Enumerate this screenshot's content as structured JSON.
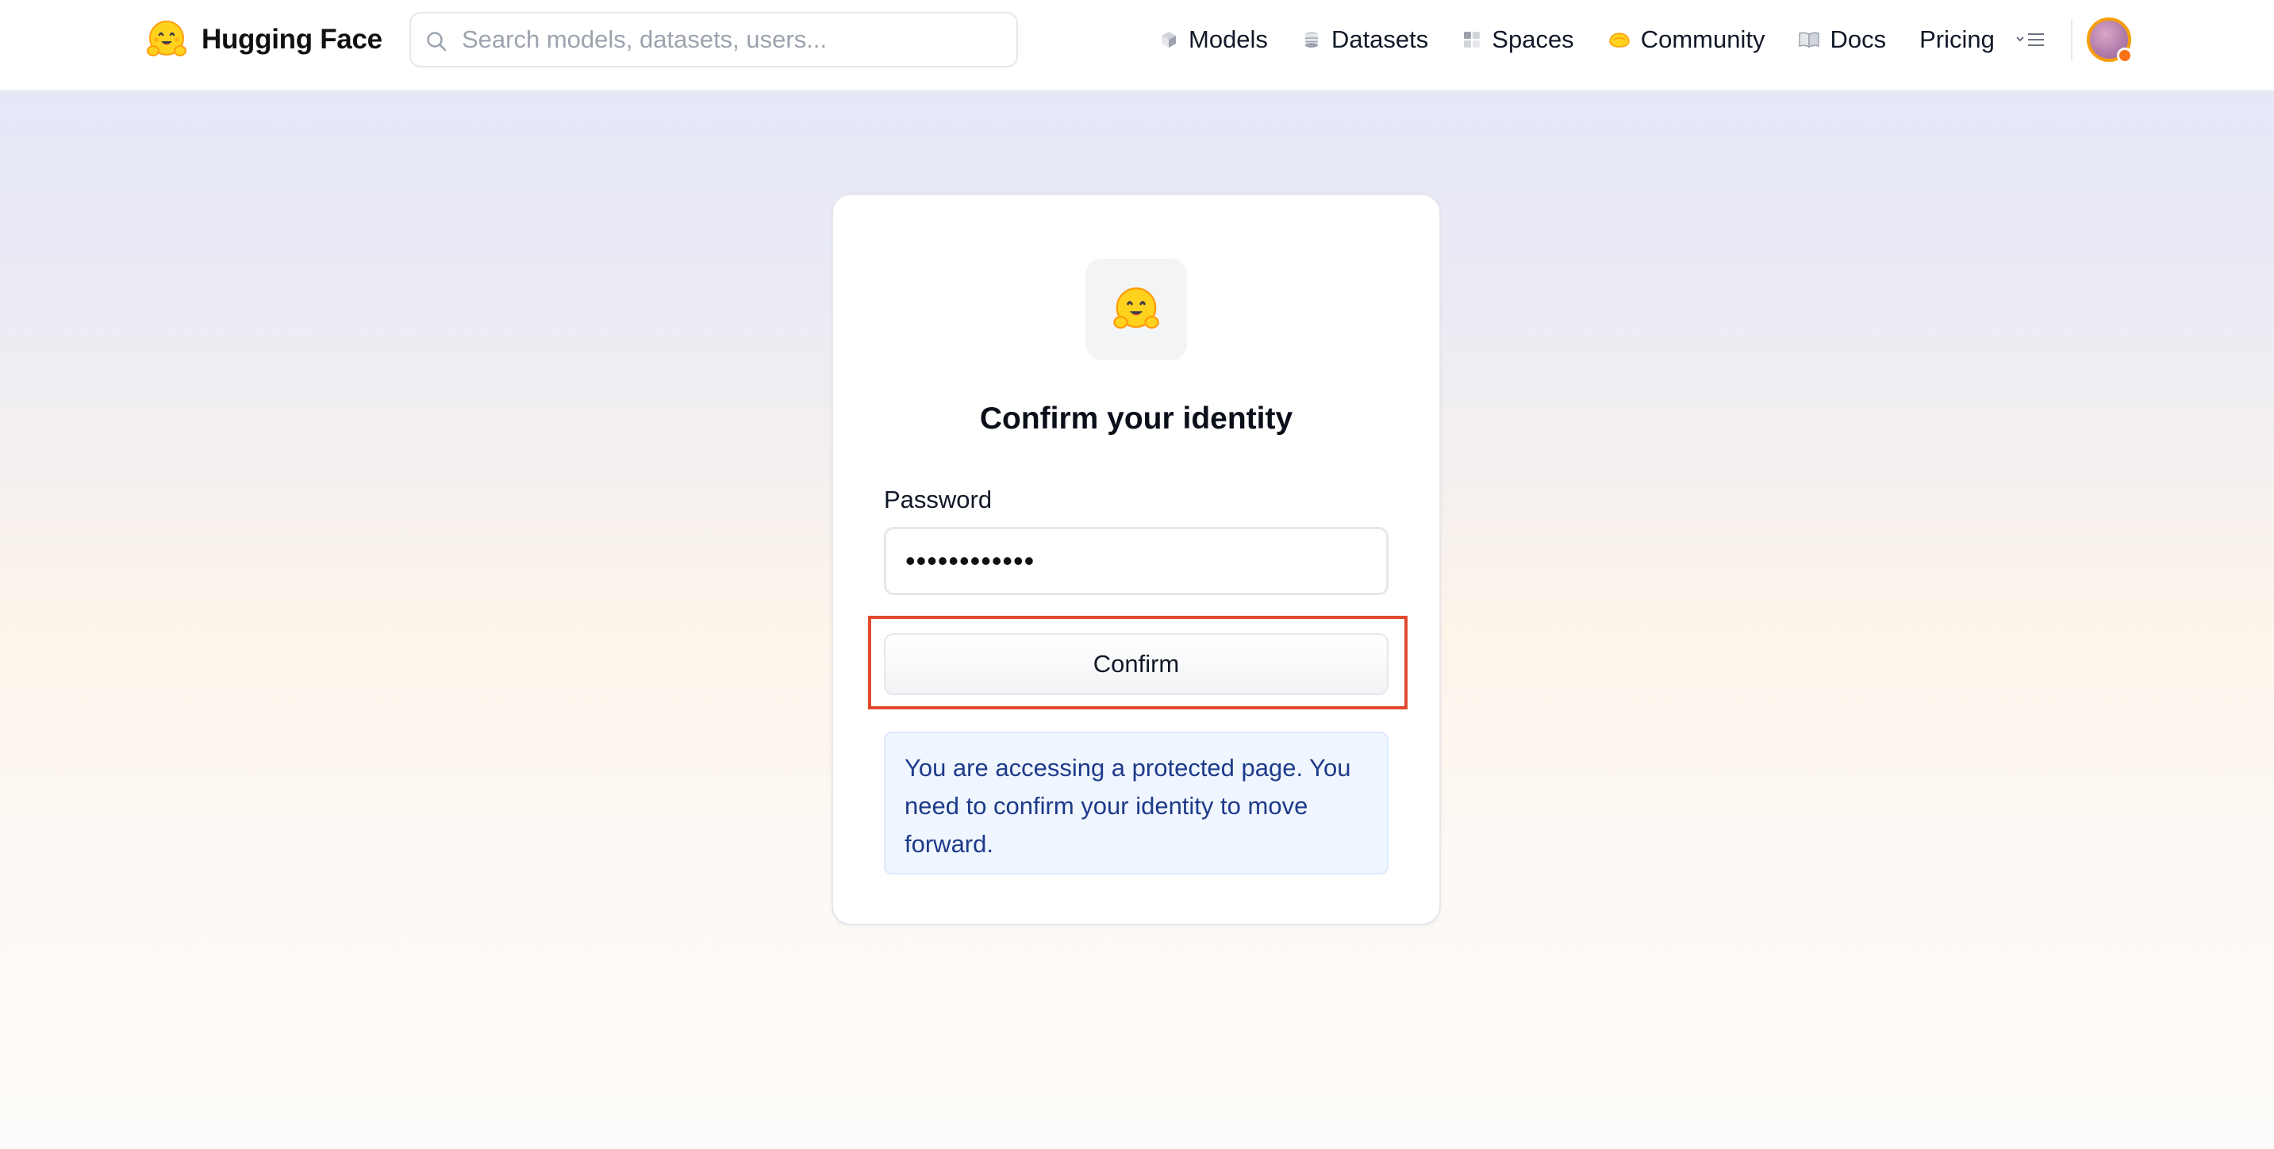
{
  "header": {
    "brand": "Hugging Face",
    "search_placeholder": "Search models, datasets, users...",
    "nav": [
      {
        "label": "Models",
        "icon": "models-icon"
      },
      {
        "label": "Datasets",
        "icon": "datasets-icon"
      },
      {
        "label": "Spaces",
        "icon": "spaces-icon"
      },
      {
        "label": "Community",
        "icon": "community-icon"
      },
      {
        "label": "Docs",
        "icon": "docs-icon"
      },
      {
        "label": "Pricing",
        "icon": ""
      }
    ],
    "menu_icon": "menu-icon",
    "avatar": "user-avatar"
  },
  "card": {
    "title": "Confirm your identity",
    "password_label": "Password",
    "password_value": "••••••••••••",
    "confirm_label": "Confirm",
    "notice": "You are accessing a protected page. You need to confirm your identity to move forward."
  },
  "colors": {
    "highlight": "#e2492d",
    "notice_bg": "#eff6ff",
    "notice_text": "#1e3a8a",
    "accent": "#f59e0b"
  }
}
